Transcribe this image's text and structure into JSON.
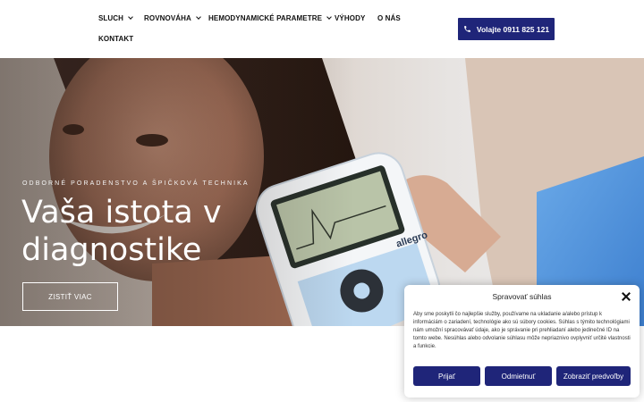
{
  "nav": {
    "items": [
      {
        "label": "SLUCH",
        "dropdown": true
      },
      {
        "label": "ROVNOVÁHA",
        "dropdown": true
      },
      {
        "label": "HEMODYNAMICKÉ PARAMETRE",
        "dropdown": true
      },
      {
        "label": "VÝHODY",
        "dropdown": false
      },
      {
        "label": "O NÁS",
        "dropdown": false
      },
      {
        "label": "KONTAKT",
        "dropdown": false
      }
    ],
    "call_button": "Volajte 0911 825 121",
    "call_icon": "phone-icon"
  },
  "hero": {
    "eyebrow": "ODBORNÉ PORADENSTVO A ŠPIČKOVÁ TECHNIKA",
    "title": "Vaša istota v diagnostike",
    "cta": "ZISTIŤ VIAC",
    "device_brand": "allegro"
  },
  "consent": {
    "title": "Spravovať súhlas",
    "text": "Aby sme poskytli čo najlepšie služby, používame na ukladanie a/alebo prístup k informáciám o zariadení, technológie ako sú súbory cookies. Súhlas s týmito technológiami nám umožní spracovávať údaje, ako je správanie pri prehliadaní alebo jedinečné ID na tomto webe. Nesúhlas alebo odvolanie súhlasu môže nepriaznivo ovplyvniť určité vlastnosti a funkcie.",
    "accept": "Prijať",
    "deny": "Odmietnuť",
    "preferences": "Zobraziť predvoľby"
  },
  "colors": {
    "brand": "#1f2579",
    "text": "#111111",
    "hero_text": "#ffffff"
  }
}
